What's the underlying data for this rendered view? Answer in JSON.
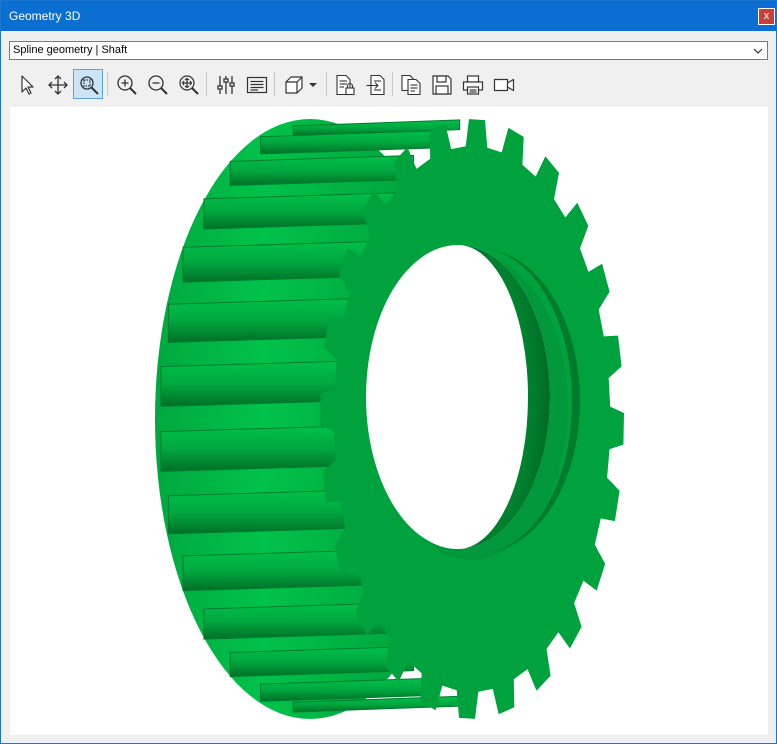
{
  "window": {
    "title": "Geometry 3D",
    "close_label": "x",
    "title_bar_color": "#0b6fd1",
    "close_color": "#c9403a"
  },
  "selector": {
    "selected": "Spline geometry | Shaft"
  },
  "toolbar": {
    "active_tool": "zoom-window",
    "buttons": [
      {
        "icon": "pointer-icon"
      },
      {
        "icon": "pan-icon"
      },
      {
        "icon": "zoom-window-icon"
      },
      {
        "icon": "zoom-in-icon"
      },
      {
        "icon": "zoom-out-icon"
      },
      {
        "icon": "zoom-extents-icon"
      },
      {
        "icon": "settings-sliders-icon"
      },
      {
        "icon": "text-lines-icon"
      },
      {
        "icon": "view-cube-icon"
      },
      {
        "icon": "report-lock-icon"
      },
      {
        "icon": "report-export-icon"
      },
      {
        "icon": "copy-icon"
      },
      {
        "icon": "save-icon"
      },
      {
        "icon": "print-icon"
      },
      {
        "icon": "video-camera-icon"
      }
    ]
  },
  "viewport": {
    "model": "spline shaft gear",
    "model_color": "#00a13c"
  }
}
